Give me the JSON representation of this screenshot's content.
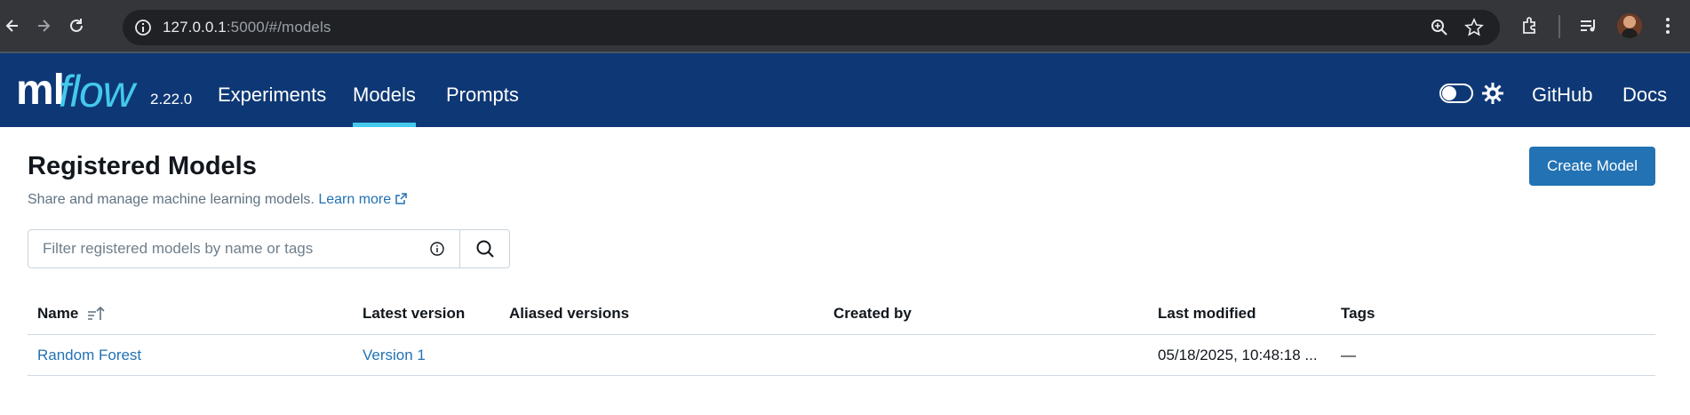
{
  "browser": {
    "url_host": "127.0.0.1",
    "url_path": ":5000/#/models"
  },
  "header": {
    "logo_ml": "ml",
    "logo_flow": "flow",
    "version": "2.22.0",
    "nav": [
      {
        "label": "Experiments"
      },
      {
        "label": "Models"
      },
      {
        "label": "Prompts"
      }
    ],
    "active_nav": "Models",
    "github_label": "GitHub",
    "docs_label": "Docs"
  },
  "page": {
    "title": "Registered Models",
    "subtitle": "Share and manage machine learning models.",
    "learn_more": "Learn more",
    "create_button": "Create Model"
  },
  "search": {
    "placeholder": "Filter registered models by name or tags",
    "value": ""
  },
  "table": {
    "columns": [
      {
        "label": "Name"
      },
      {
        "label": "Latest version"
      },
      {
        "label": "Aliased versions"
      },
      {
        "label": "Created by"
      },
      {
        "label": "Last modified"
      },
      {
        "label": "Tags"
      }
    ],
    "rows": [
      {
        "name": "Random Forest",
        "latest_version": "Version 1",
        "aliased_versions": "",
        "created_by": "",
        "last_modified": "05/18/2025, 10:48:18 ...",
        "tags": "—"
      }
    ]
  },
  "colors": {
    "header_bg": "#0e3875",
    "accent": "#43c9ed",
    "primary": "#2272b4"
  }
}
